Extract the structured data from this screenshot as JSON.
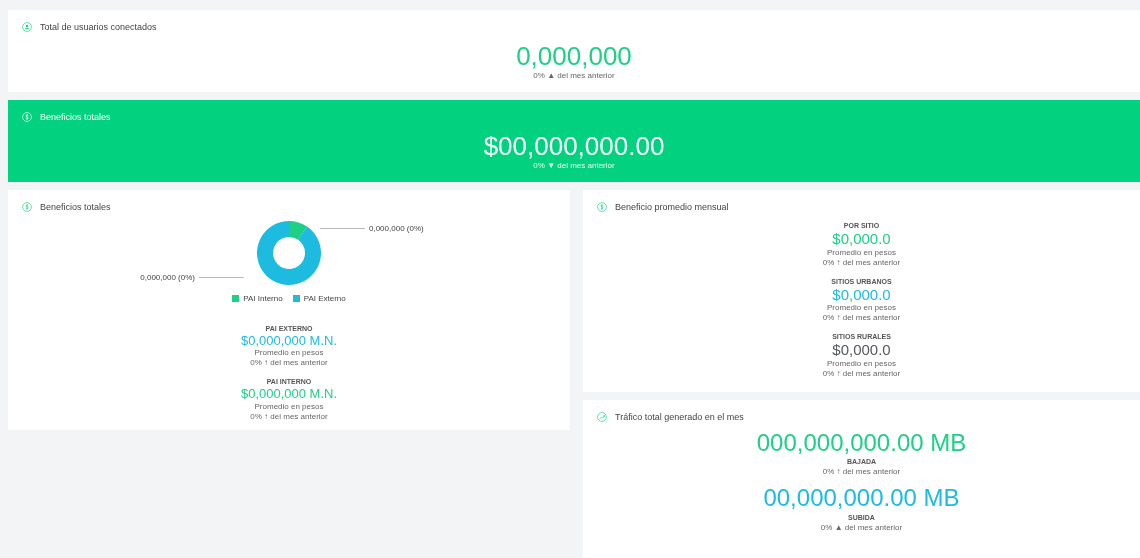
{
  "cards": [
    {
      "kind": "stat",
      "title": "Total de usuarios conectados",
      "value": "0,000,000",
      "change": "0% ▲ del mes anterior",
      "highlighted": false
    },
    {
      "kind": "stat",
      "title": "Beneficios totales",
      "value": "$00,000,000.00",
      "change": "0% ▼ del mes anterior",
      "highlighted": true
    }
  ],
  "pai_card": {
    "title": "Beneficios totales",
    "donut": {
      "labels": [
        "0,000,000 (0%)",
        "0,000,000 (0%)"
      ],
      "legend": [
        {
          "label": "PAI Interno",
          "color": "#1fcf86"
        },
        {
          "label": "PAI Externo",
          "color": "#1ebbe0"
        }
      ]
    },
    "metrics": [
      {
        "kind": "label-top",
        "label": "PAI EXTERNO",
        "value": "$0,000,000 M.N.",
        "color": "#1ebbe0",
        "note": "Promedio en pesos",
        "change": "0% ↑ del mes anterior"
      },
      {
        "kind": "label-top",
        "label": "PAI INTERNO",
        "value": "$0,000,000 M.N.",
        "color": "#1fcf86",
        "note": "Promedio en pesos",
        "change": "0% ↑ del mes anterior"
      }
    ]
  },
  "average_card": {
    "title": "Beneficio promedio mensual",
    "metrics": [
      {
        "kind": "label-top",
        "label": "POR SITIO",
        "value": "$0,000.0",
        "color": "#1fcf86",
        "note": "Promedio en pesos",
        "change": "0% ↑ del mes anterior"
      },
      {
        "kind": "label-top",
        "label": "SITIOS URBANOS",
        "value": "$0,000.0",
        "color": "#1ebbe0",
        "note": "Promedio en pesos",
        "change": "0% ↑ del mes anterior"
      },
      {
        "kind": "label-top",
        "label": "SITIOS RURALES",
        "value": "$0,000.0",
        "color": "#555a5f",
        "note": "Promedio en pesos",
        "change": "0% ↑ del mes anterior"
      }
    ]
  },
  "traffic_card": {
    "title": "Tráfico total generado en el mes",
    "metrics": [
      {
        "kind": "label-below",
        "label": "BAJADA",
        "value": "000,000,000.00 MB",
        "color": "#1fcf86",
        "change": "0% ↑ del mes anterior"
      },
      {
        "kind": "label-below",
        "label": "SUBIDA",
        "value": "00,000,000.00 MB",
        "color": "#1ebbe0",
        "change": "0% ▲ del mes anterior"
      }
    ]
  }
}
